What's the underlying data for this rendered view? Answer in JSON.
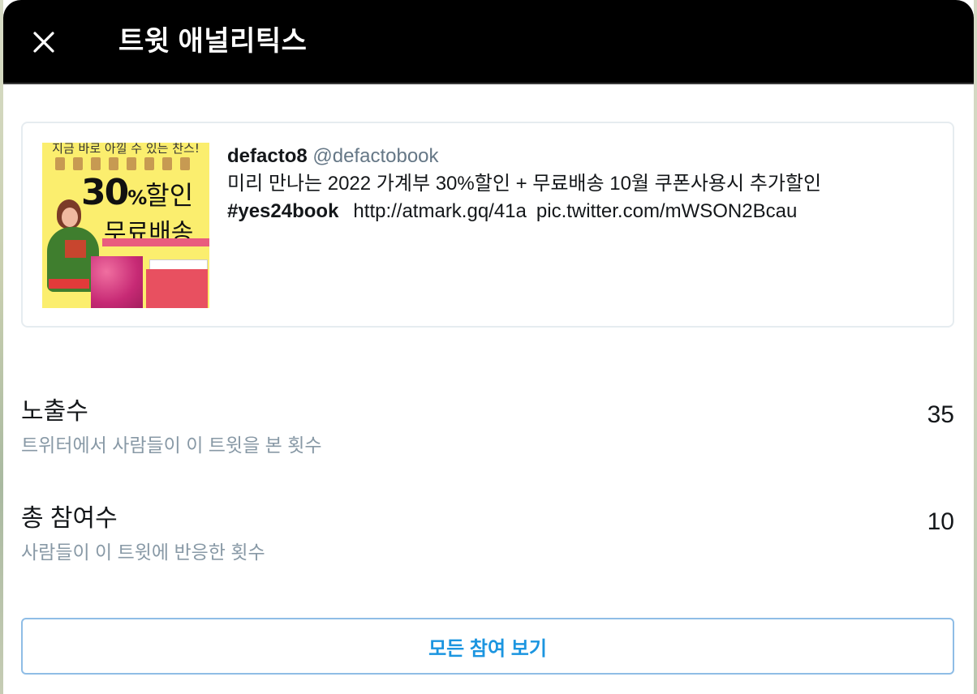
{
  "header": {
    "title": "트윗 애널리틱스",
    "close_icon": "close-icon"
  },
  "tweet": {
    "author_name": "defacto8",
    "author_handle": "@defactobook",
    "text": "미리 만나는 2022 가계부 30%할인 + 무료배송 10월 쿠폰사용시 추가할인",
    "hashtag": "#yes24book",
    "link": "http://atmark.gq/41a",
    "pic_link": "pic.twitter.com/mWSON2Bcau",
    "thumbnail": {
      "top_line": "지금 바로 아낄 수 있는 찬스!",
      "percent": "30",
      "percent_sign": "%",
      "discount_word": "할인",
      "free_shipping": "무료배송"
    }
  },
  "metrics": [
    {
      "title": "노출수",
      "description": "트위터에서 사람들이 이 트윗을 본 횟수",
      "value": "35"
    },
    {
      "title": "총 참여수",
      "description": "사람들이 이 트윗에 반응한 횟수",
      "value": "10"
    }
  ],
  "actions": {
    "view_all_label": "모든 참여 보기"
  },
  "colors": {
    "header_bg": "#000000",
    "accent": "#1b95e0",
    "muted_text": "#8899a6",
    "thumbnail_bg": "#fbee6e"
  }
}
